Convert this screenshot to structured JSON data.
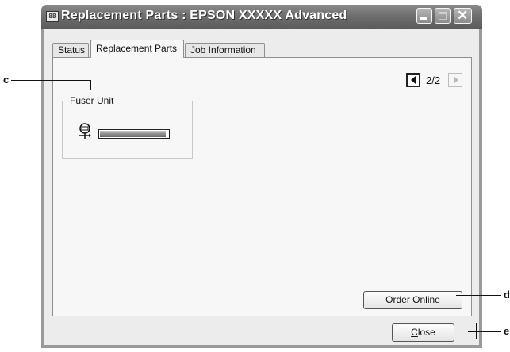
{
  "window": {
    "icon_text": "88",
    "title": "Replacement Parts : EPSON XXXXX Advanced"
  },
  "tabs": [
    {
      "label": "Status"
    },
    {
      "label": "Replacement Parts",
      "selected": true
    },
    {
      "label": "Job Information"
    }
  ],
  "page_nav": {
    "page": "2/2"
  },
  "fuser_unit": {
    "label": "Fuser Unit",
    "icon": "fuser-icon",
    "level_fraction": 0.97
  },
  "buttons": {
    "order_online_first": "O",
    "order_online_rest": "rder Online",
    "close_first": "C",
    "close_rest": "lose"
  },
  "callouts": {
    "c": "c",
    "d": "d",
    "e": "e"
  },
  "colors": {
    "titlebar": "#6f6f6f",
    "panel": "#f7f7f7"
  }
}
